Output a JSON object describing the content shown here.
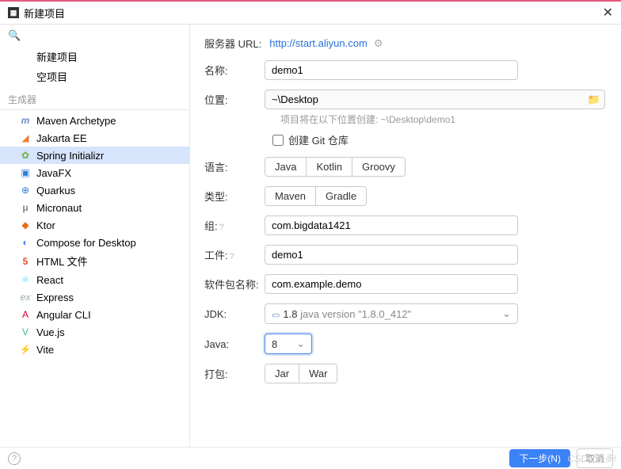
{
  "title": "新建项目",
  "sidebar": {
    "categories": [
      {
        "label": "新建项目",
        "items": [
          {
            "label": "新建项目",
            "icon": ""
          },
          {
            "label": "空项目",
            "icon": ""
          }
        ]
      },
      {
        "label": "生成器",
        "items": [
          {
            "label": "Maven Archetype",
            "icon": "m",
            "iconClass": "icon-m"
          },
          {
            "label": "Jakarta EE",
            "icon": "◢",
            "iconClass": "icon-orange"
          },
          {
            "label": "Spring Initializr",
            "icon": "✿",
            "iconClass": "icon-green",
            "selected": true
          },
          {
            "label": "JavaFX",
            "icon": "▣",
            "iconClass": "icon-blue"
          },
          {
            "label": "Quarkus",
            "icon": "⊕",
            "iconClass": "icon-blue"
          },
          {
            "label": "Micronaut",
            "icon": "μ",
            "iconClass": "icon-mu"
          },
          {
            "label": "Ktor",
            "icon": "◆",
            "iconClass": "icon-ktor"
          },
          {
            "label": "Compose for Desktop",
            "icon": "◐",
            "iconClass": "icon-compose"
          },
          {
            "label": "HTML 文件",
            "icon": "5",
            "iconClass": "icon-html5"
          },
          {
            "label": "React",
            "icon": "⚛",
            "iconClass": "icon-react"
          },
          {
            "label": "Express",
            "icon": "ex",
            "iconClass": "icon-ex"
          },
          {
            "label": "Angular CLI",
            "icon": "A",
            "iconClass": "icon-angular"
          },
          {
            "label": "Vue.js",
            "icon": "V",
            "iconClass": "icon-vue"
          },
          {
            "label": "Vite",
            "icon": "⚡",
            "iconClass": "icon-vite"
          }
        ]
      }
    ]
  },
  "form": {
    "server_url_label": "服务器 URL:",
    "server_url": "http://start.aliyun.com",
    "name_label": "名称:",
    "name_value": "demo1",
    "location_label": "位置:",
    "location_value": "~\\Desktop",
    "location_hint": "项目将在以下位置创建: ~\\Desktop\\demo1",
    "git_label": "创建 Git 仓库",
    "language_label": "语言:",
    "language_options": [
      "Java",
      "Kotlin",
      "Groovy"
    ],
    "type_label": "类型:",
    "type_options": [
      "Maven",
      "Gradle"
    ],
    "group_label": "组:",
    "group_value": "com.bigdata1421",
    "artifact_label": "工件:",
    "artifact_value": "demo1",
    "package_label": "软件包名称:",
    "package_value": "com.example.demo",
    "jdk_label": "JDK:",
    "jdk_value": "1.8",
    "jdk_detail": "java version \"1.8.0_412\"",
    "java_label": "Java:",
    "java_value": "8",
    "packaging_label": "打包:",
    "packaging_options": [
      "Jar",
      "War"
    ]
  },
  "footer": {
    "next": "下一步(N)",
    "cancel": "取消"
  },
  "watermark": "CSDN多多!"
}
